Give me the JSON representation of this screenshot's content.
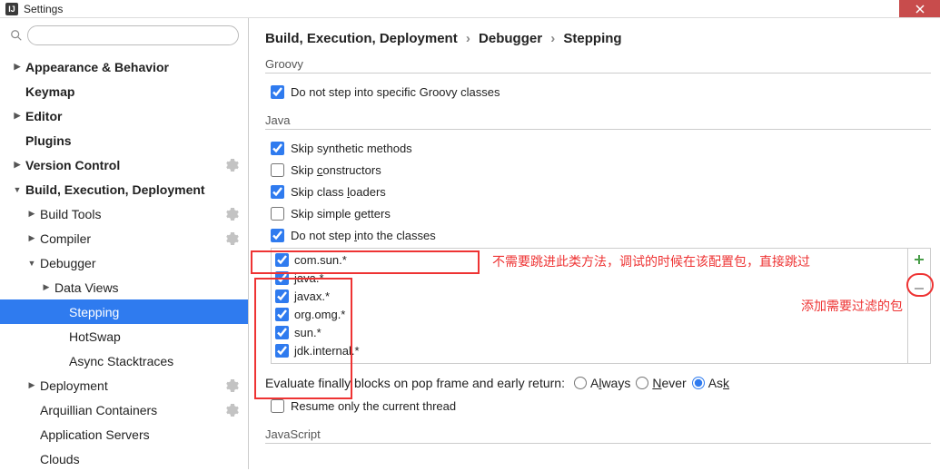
{
  "window": {
    "title": "Settings"
  },
  "sidebar": {
    "search_placeholder": "",
    "items": [
      {
        "label": "Appearance & Behavior",
        "bold": true,
        "caret": "right",
        "indent": 0,
        "gear": false
      },
      {
        "label": "Keymap",
        "bold": true,
        "caret": "",
        "indent": 0,
        "gear": false
      },
      {
        "label": "Editor",
        "bold": true,
        "caret": "right",
        "indent": 0,
        "gear": false
      },
      {
        "label": "Plugins",
        "bold": true,
        "caret": "",
        "indent": 0,
        "gear": false
      },
      {
        "label": "Version Control",
        "bold": true,
        "caret": "right",
        "indent": 0,
        "gear": true
      },
      {
        "label": "Build, Execution, Deployment",
        "bold": true,
        "caret": "down",
        "indent": 0,
        "gear": false
      },
      {
        "label": "Build Tools",
        "bold": false,
        "caret": "right",
        "indent": 1,
        "gear": true
      },
      {
        "label": "Compiler",
        "bold": false,
        "caret": "right",
        "indent": 1,
        "gear": true
      },
      {
        "label": "Debugger",
        "bold": false,
        "caret": "down",
        "indent": 1,
        "gear": false
      },
      {
        "label": "Data Views",
        "bold": false,
        "caret": "right",
        "indent": 2,
        "gear": false
      },
      {
        "label": "Stepping",
        "bold": false,
        "caret": "",
        "indent": 3,
        "gear": false,
        "selected": true
      },
      {
        "label": "HotSwap",
        "bold": false,
        "caret": "",
        "indent": 3,
        "gear": false
      },
      {
        "label": "Async Stacktraces",
        "bold": false,
        "caret": "",
        "indent": 3,
        "gear": false
      },
      {
        "label": "Deployment",
        "bold": false,
        "caret": "right",
        "indent": 1,
        "gear": true
      },
      {
        "label": "Arquillian Containers",
        "bold": false,
        "caret": "",
        "indent": 1,
        "gear": true
      },
      {
        "label": "Application Servers",
        "bold": false,
        "caret": "",
        "indent": 1,
        "gear": false
      },
      {
        "label": "Clouds",
        "bold": false,
        "caret": "",
        "indent": 1,
        "gear": false
      }
    ]
  },
  "breadcrumb": {
    "a": "Build, Execution, Deployment",
    "b": "Debugger",
    "c": "Stepping",
    "sep": "›"
  },
  "groovy": {
    "title": "Groovy",
    "dont_step": "Do not step into specific Groovy classes"
  },
  "java": {
    "title": "Java",
    "skip_synthetic": "Skip synthetic methods",
    "skip_constructors_pre": "Skip ",
    "skip_constructors_u": "c",
    "skip_constructors_post": "onstructors",
    "skip_classloaders_pre": "Skip class ",
    "skip_classloaders_u": "l",
    "skip_classloaders_post": "oaders",
    "skip_getters_pre": "Skip simple ",
    "skip_getters_u": "g",
    "skip_getters_post": "etters",
    "dont_step_pre": "Do not step ",
    "dont_step_u": "i",
    "dont_step_post": "nto the classes",
    "class_patterns": [
      "com.sun.*",
      "java.*",
      "javax.*",
      "org.omg.*",
      "sun.*",
      "jdk.internal.*"
    ],
    "evaluate_label": "Evaluate finally blocks on pop frame and early return:",
    "always_pre": "A",
    "always_u": "l",
    "always_post": "ways",
    "never_pre": "",
    "never_u": "N",
    "never_post": "ever",
    "ask_pre": "As",
    "ask_u": "k",
    "ask_post": "",
    "resume": "Resume only the current thread"
  },
  "javascript": {
    "title": "JavaScript"
  },
  "annotations": {
    "line1": "不需要跳进此类方法，调试的时候在该配置包，直接跳过",
    "line2": "添加需要过滤的包"
  }
}
